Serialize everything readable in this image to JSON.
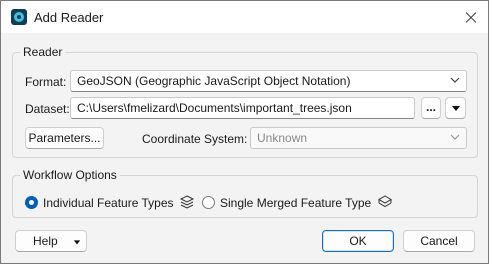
{
  "window": {
    "title": "Add Reader"
  },
  "reader": {
    "group_label": "Reader",
    "format_label": "Format:",
    "format_value": "GeoJSON (Geographic JavaScript Object Notation)",
    "dataset_label": "Dataset:",
    "dataset_value": "C:\\Users\\fmelizard\\Documents\\important_trees.json",
    "browse_label": "...",
    "parameters_label": "Parameters...",
    "coord_label": "Coordinate System:",
    "coord_value": "Unknown"
  },
  "workflow": {
    "group_label": "Workflow Options",
    "options": [
      {
        "label": "Individual Feature Types",
        "selected": true
      },
      {
        "label": "Single Merged Feature Type",
        "selected": false
      }
    ]
  },
  "footer": {
    "help_label": "Help",
    "ok_label": "OK",
    "cancel_label": "Cancel"
  },
  "icons": {
    "app": "fme-app-icon",
    "close": "close-icon",
    "dropdown": "chevron-down-icon",
    "layers": "layers-icon"
  },
  "colors": {
    "accent": "#005fb8",
    "default_button_border": "#1a6fc4",
    "dialog_bg": "#f3f3f3"
  }
}
